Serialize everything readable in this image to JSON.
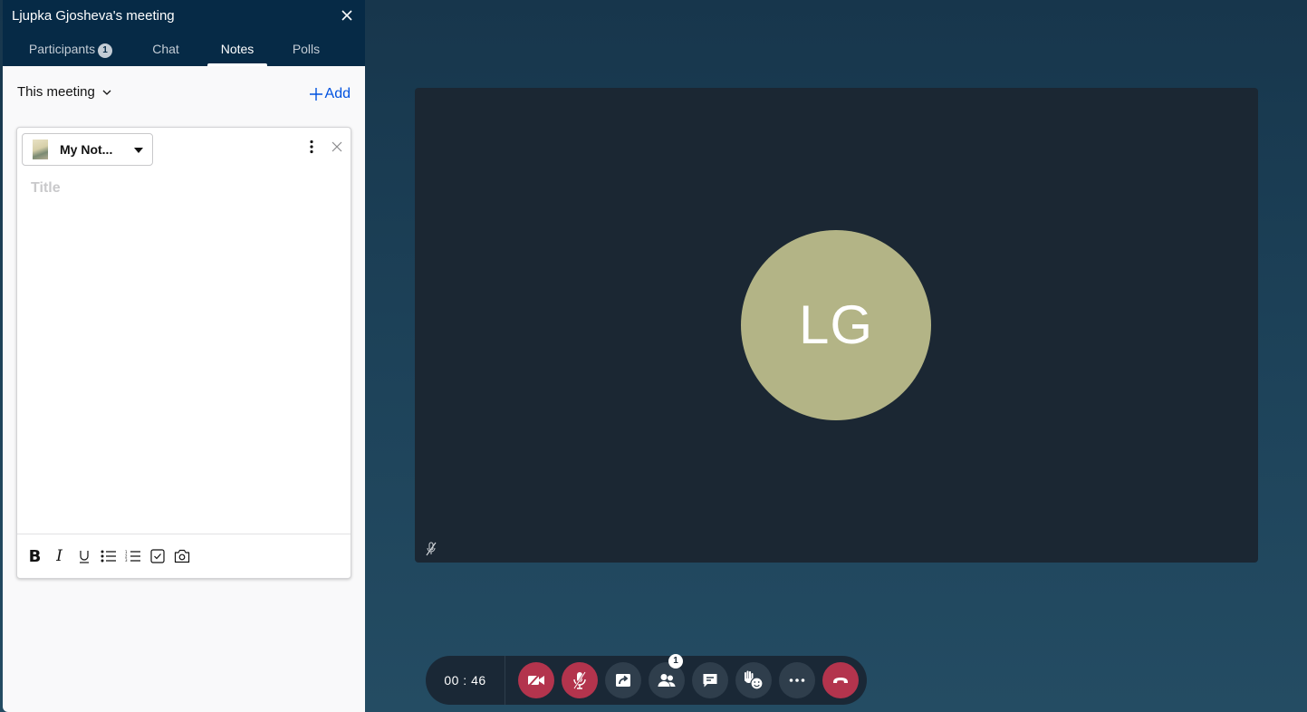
{
  "panel": {
    "title": "Ljupka Gjosheva's meeting",
    "tabs": [
      {
        "label": "Participants",
        "badge": "1",
        "active": false
      },
      {
        "label": "Chat",
        "active": false
      },
      {
        "label": "Notes",
        "active": true
      },
      {
        "label": "Polls",
        "active": false
      }
    ],
    "scope_label": "This meeting",
    "add_label": "Add"
  },
  "note": {
    "selector_label": "My Not...",
    "title_placeholder": "Title",
    "title_value": "",
    "toolbar": [
      "bold",
      "italic",
      "underline",
      "bulleted-list",
      "numbered-list",
      "checklist",
      "camera"
    ]
  },
  "video": {
    "initials": "LG",
    "avatar_color": "#b3b486",
    "muted": true
  },
  "controls": {
    "timer": "00 : 46",
    "participants_badge": "1",
    "buttons": [
      "stop-video",
      "unmute",
      "share-screen",
      "participants",
      "chat",
      "reactions",
      "more",
      "leave"
    ]
  },
  "colors": {
    "accent": "#0052e0",
    "header": "#062a46",
    "danger": "#b3344d"
  }
}
